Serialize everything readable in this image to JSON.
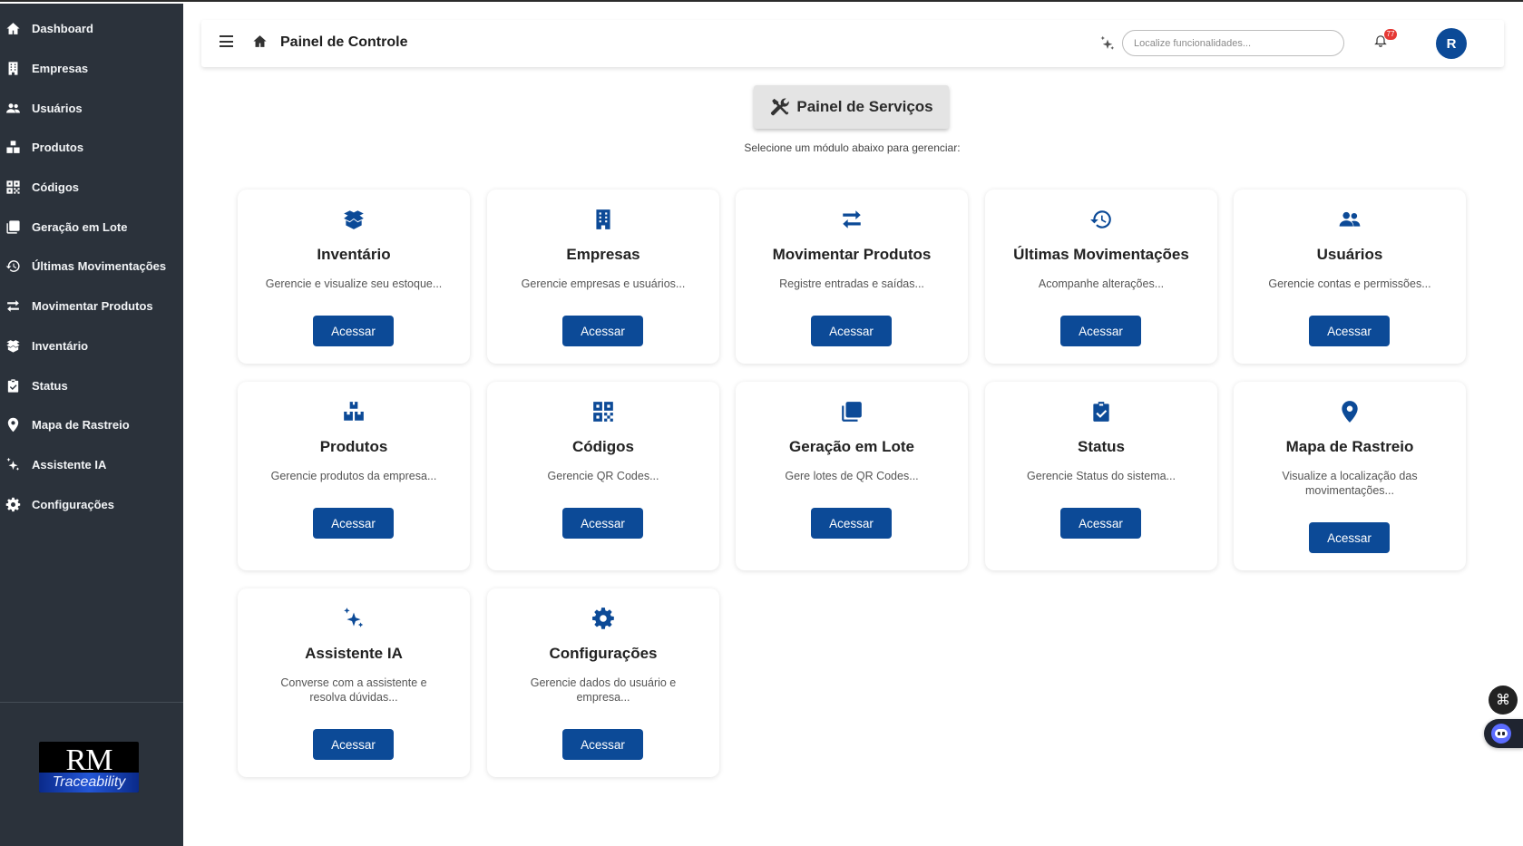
{
  "sidebar": {
    "items": [
      {
        "label": "Dashboard",
        "icon": "home-icon"
      },
      {
        "label": "Empresas",
        "icon": "building-icon"
      },
      {
        "label": "Usuários",
        "icon": "users-icon"
      },
      {
        "label": "Produtos",
        "icon": "boxes-icon"
      },
      {
        "label": "Códigos",
        "icon": "qrcode-icon"
      },
      {
        "label": "Geração em Lote",
        "icon": "copy-icon"
      },
      {
        "label": "Últimas Movimentações",
        "icon": "history-icon"
      },
      {
        "label": "Movimentar Produtos",
        "icon": "exchange-icon"
      },
      {
        "label": "Inventário",
        "icon": "box-open-icon"
      },
      {
        "label": "Status",
        "icon": "clipboard-check-icon"
      },
      {
        "label": "Mapa de Rastreio",
        "icon": "map-pin-icon"
      },
      {
        "label": "Assistente IA",
        "icon": "sparkles-icon"
      },
      {
        "label": "Configurações",
        "icon": "gear-icon"
      }
    ],
    "logo": {
      "line1": "RM",
      "line2": "Traceability"
    }
  },
  "header": {
    "title": "Painel de Controle",
    "search_placeholder": "Localize funcionalidades...",
    "notification_count": "77",
    "avatar_initial": "R"
  },
  "panel": {
    "title": "Painel de Serviços",
    "subtitle": "Selecione um módulo abaixo para gerenciar:"
  },
  "cards": [
    {
      "title": "Inventário",
      "desc": "Gerencie e visualize seu estoque...",
      "button": "Acessar",
      "icon": "box-open-icon"
    },
    {
      "title": "Empresas",
      "desc": "Gerencie empresas e usuários...",
      "button": "Acessar",
      "icon": "building-icon"
    },
    {
      "title": "Movimentar Produtos",
      "desc": "Registre entradas e saídas...",
      "button": "Acessar",
      "icon": "exchange-icon"
    },
    {
      "title": "Últimas Movimentações",
      "desc": "Acompanhe alterações...",
      "button": "Acessar",
      "icon": "history-icon"
    },
    {
      "title": "Usuários",
      "desc": "Gerencie contas e permissões...",
      "button": "Acessar",
      "icon": "users-icon"
    },
    {
      "title": "Produtos",
      "desc": "Gerencie produtos da empresa...",
      "button": "Acessar",
      "icon": "boxes-icon"
    },
    {
      "title": "Códigos",
      "desc": "Gerencie QR Codes...",
      "button": "Acessar",
      "icon": "qrcode-icon"
    },
    {
      "title": "Geração em Lote",
      "desc": "Gere lotes de QR Codes...",
      "button": "Acessar",
      "icon": "copy-icon"
    },
    {
      "title": "Status",
      "desc": "Gerencie Status do sistema...",
      "button": "Acessar",
      "icon": "clipboard-check-icon"
    },
    {
      "title": "Mapa de Rastreio",
      "desc": "Visualize a localização das movimentações...",
      "button": "Acessar",
      "icon": "map-pin-icon"
    },
    {
      "title": "Assistente IA",
      "desc": "Converse com a assistente e resolva dúvidas...",
      "button": "Acessar",
      "icon": "sparkles-icon"
    },
    {
      "title": "Configurações",
      "desc": "Gerencie dados do usuário e empresa...",
      "button": "Acessar",
      "icon": "gear-icon"
    }
  ],
  "colors": {
    "brand": "#0c4a97",
    "sidebar_bg": "#2b323b",
    "badge": "#e53935"
  }
}
